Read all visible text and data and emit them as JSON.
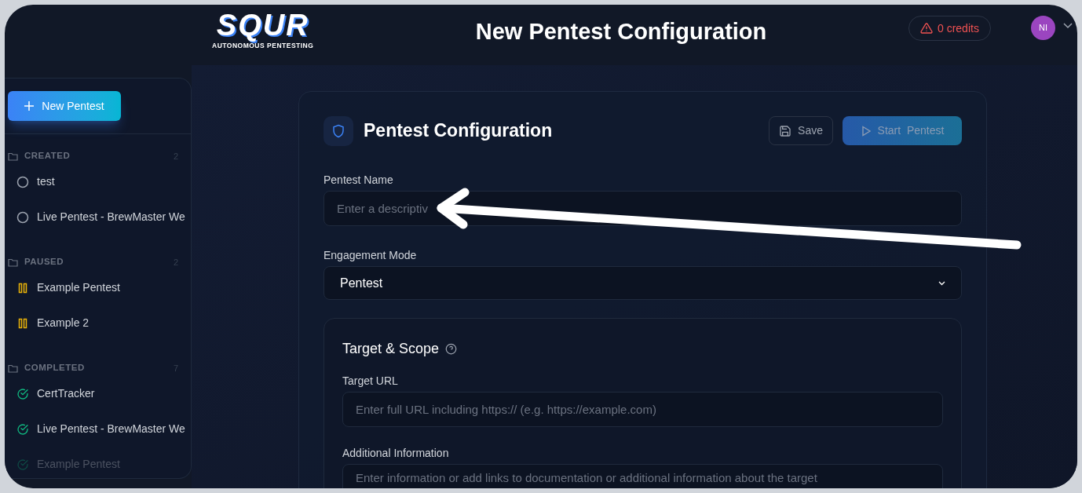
{
  "header": {
    "logo": {
      "wordmark": "SQUR",
      "tagline": "AUTONOMOUS PENTESTING"
    },
    "title": "New Pentest Configuration",
    "credits": "0 credits",
    "avatar": "NI"
  },
  "sidebar": {
    "new_button": "New Pentest",
    "sections": [
      {
        "kind": "created",
        "title": "CREATED",
        "count": "2",
        "items": [
          "test",
          "Live Pentest - BrewMaster We"
        ]
      },
      {
        "kind": "paused",
        "title": "PAUSED",
        "count": "2",
        "items": [
          "Example Pentest",
          "Example 2"
        ]
      },
      {
        "kind": "completed",
        "title": "COMPLETED",
        "count": "7",
        "items": [
          "CertTracker",
          "Live Pentest - BrewMaster We",
          "Example Pentest"
        ]
      }
    ]
  },
  "form": {
    "title": "Pentest Configuration",
    "buttons": [
      {
        "kind": "save",
        "label": "Save",
        "disabled": false
      },
      {
        "kind": "start",
        "label": "Start  Pentest",
        "disabled": true
      }
    ],
    "name_field": {
      "label": "Pentest Name",
      "placeholder": "Enter a descriptiv"
    },
    "mode_field": {
      "label": "Engagement Mode",
      "value": "Pentest"
    },
    "target_scope": {
      "title": "Target & Scope",
      "url_field": {
        "label": "Target URL",
        "placeholder": "Enter full URL including https:// (e.g. https://example.com)"
      },
      "info_field": {
        "label": "Additional Information",
        "placeholder": "Enter information or add links to documentation or additional information about the target"
      }
    }
  }
}
